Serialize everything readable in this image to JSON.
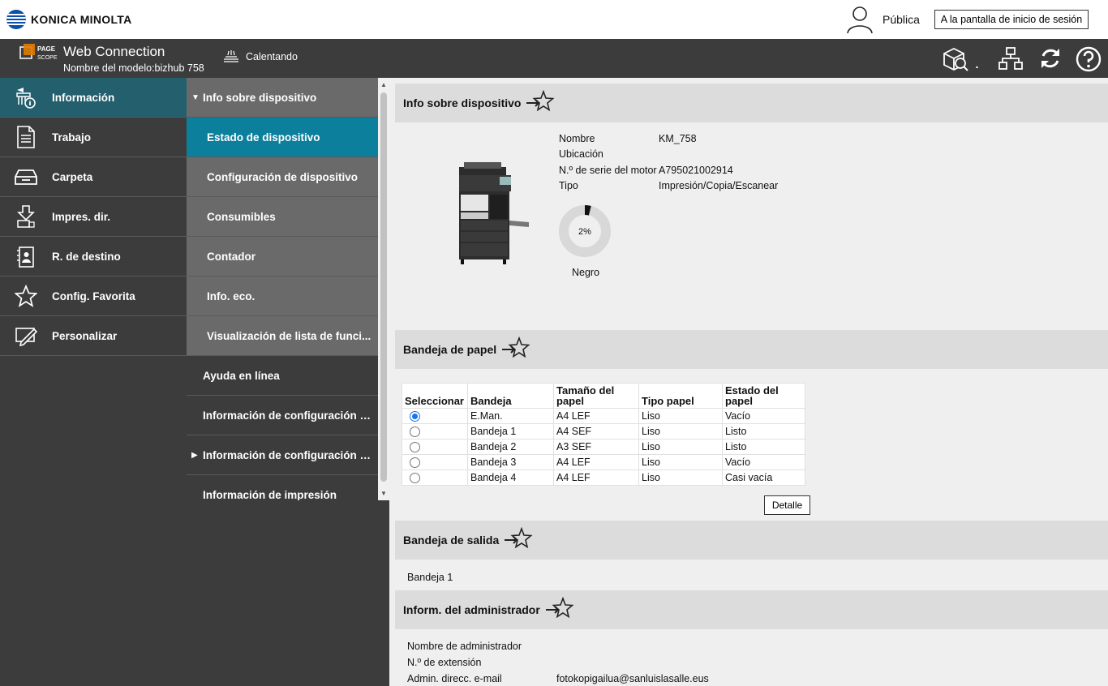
{
  "brand": {
    "name": "KONICA MINOLTA"
  },
  "top": {
    "user_label": "Pública",
    "login_button": "A la pantalla de inicio de sesión"
  },
  "header": {
    "pagescope_top": "PAGE",
    "pagescope_bottom": "SCOPE",
    "app_title": "Web Connection",
    "model": "Nombre del modelo:bizhub 758",
    "status": "Calentando"
  },
  "leftnav": [
    {
      "label": "Información",
      "icon": "info-device-icon",
      "active": true
    },
    {
      "label": "Trabajo",
      "icon": "document-icon"
    },
    {
      "label": "Carpeta",
      "icon": "folder-tray-icon"
    },
    {
      "label": "Impres. dir.",
      "icon": "direct-print-icon"
    },
    {
      "label": "R. de destino",
      "icon": "address-book-icon"
    },
    {
      "label": "Config. Favorita",
      "icon": "star-icon"
    },
    {
      "label": "Personalizar",
      "icon": "customize-icon"
    }
  ],
  "subnav": {
    "head": "Info sobre dispositivo",
    "items": [
      "Estado de dispositivo",
      "Configuración de dispositivo",
      "Consumibles",
      "Contador",
      "Info. eco.",
      "Visualización de lista de funci..."
    ],
    "extra": [
      "Ayuda en línea",
      "Información de configuración d...",
      "Información de configuración d...",
      "Información de impresión"
    ]
  },
  "device_info": {
    "title": "Info sobre dispositivo",
    "rows": [
      {
        "k": "Nombre",
        "v": "KM_758"
      },
      {
        "k": "Ubicación",
        "v": ""
      },
      {
        "k": "N.º de serie del motor",
        "v": "A795021002914"
      },
      {
        "k": "Tipo",
        "v": "Impresión/Copia/Escanear"
      }
    ],
    "toner": {
      "percent_label": "2%",
      "color_label": "Negro",
      "level": 0.02
    }
  },
  "paper_tray": {
    "title": "Bandeja de papel",
    "columns": [
      "Seleccionar",
      "Bandeja",
      "Tamaño del papel",
      "Tipo papel",
      "Estado del papel"
    ],
    "rows": [
      {
        "tray": "E.Man.",
        "size": "A4 LEF",
        "type": "Liso",
        "state": "Vacío",
        "selected": true
      },
      {
        "tray": "Bandeja 1",
        "size": "A4 SEF",
        "type": "Liso",
        "state": "Listo"
      },
      {
        "tray": "Bandeja 2",
        "size": "A3 SEF",
        "type": "Liso",
        "state": "Listo"
      },
      {
        "tray": "Bandeja 3",
        "size": "A4 LEF",
        "type": "Liso",
        "state": "Vacío"
      },
      {
        "tray": "Bandeja 4",
        "size": "A4 LEF",
        "type": "Liso",
        "state": "Casi vacía"
      }
    ],
    "detail_button": "Detalle"
  },
  "output_tray": {
    "title": "Bandeja de salida",
    "value": "Bandeja 1"
  },
  "admin": {
    "title": "Inform. del administrador",
    "rows": [
      {
        "k": "Nombre de administrador",
        "v": ""
      },
      {
        "k": "N.º de extensión",
        "v": ""
      },
      {
        "k": "Admin. direcc. e-mail",
        "v": "fotokopigailua@sanluislasalle.eus"
      }
    ]
  },
  "colors": {
    "header": "#3c3c3c",
    "active_nav": "#245f6e",
    "active_sub": "#0c7f9d",
    "sub_bg": "#6a6a6a",
    "section_hdr": "#dcdcdc",
    "main_bg": "#efefef"
  }
}
